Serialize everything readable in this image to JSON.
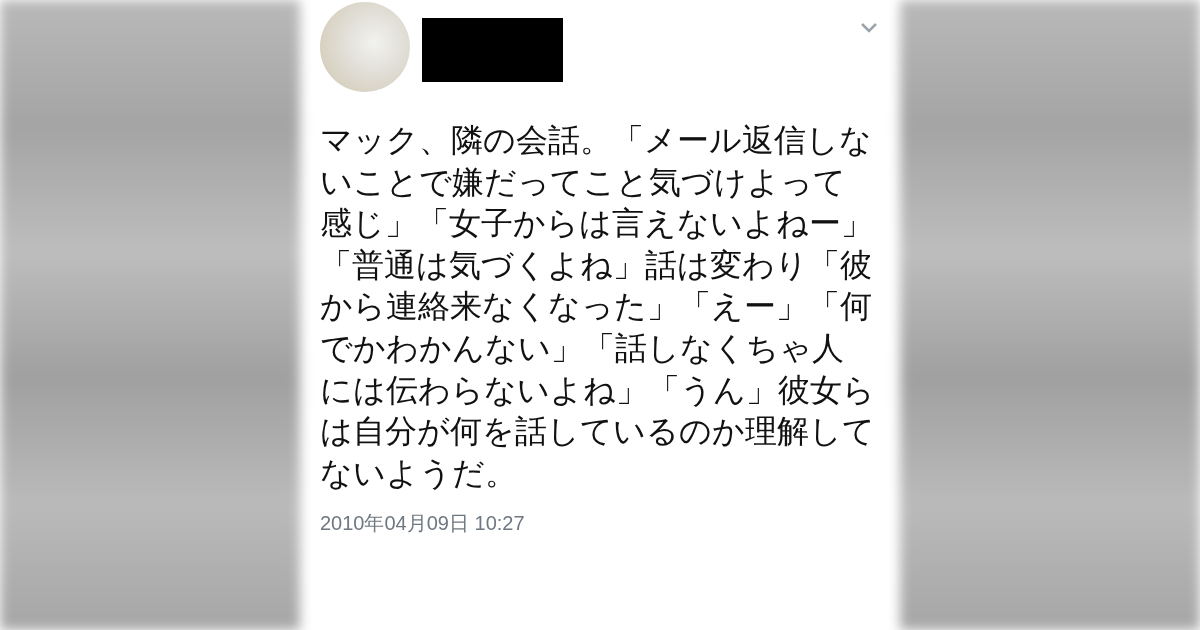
{
  "tweet": {
    "author_redacted": true,
    "text": "マック、隣の会話。「メール返信しないことで嫌だってこと気づけよって感じ」「女子からは言えないよねー」「普通は気づくよね」話は変わり「彼から連絡来なくなった」「えー」「何でかわかんない」「話しなくちゃ人には伝わらないよね」「うん」彼女らは自分が何を話しているのか理解してないようだ。",
    "timestamp": "2010年04月09日 10:27"
  }
}
